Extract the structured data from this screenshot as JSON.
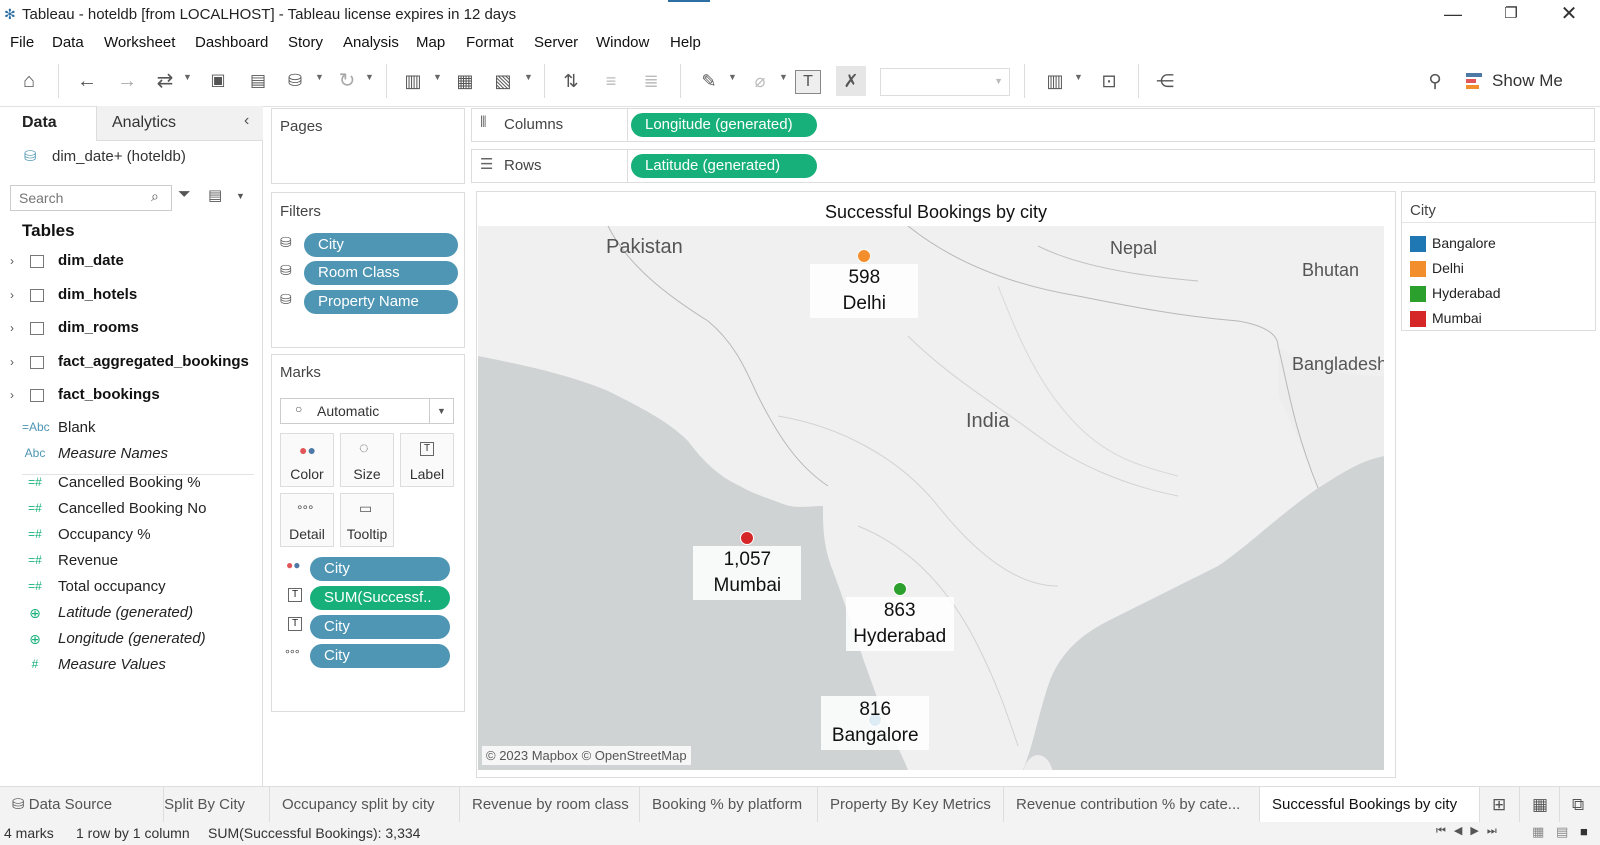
{
  "window": {
    "title": "Tableau - hoteldb [from LOCALHOST] - Tableau license expires in 12 days"
  },
  "menu": [
    "File",
    "Data",
    "Worksheet",
    "Dashboard",
    "Story",
    "Analysis",
    "Map",
    "Format",
    "Server",
    "Window",
    "Help"
  ],
  "toolbar": {
    "show_me": "Show Me"
  },
  "data_pane": {
    "tab_data": "Data",
    "tab_analytics": "Analytics",
    "datasource": "dim_date+ (hoteldb)",
    "search_placeholder": "Search",
    "tables_header": "Tables",
    "tables": [
      "dim_date",
      "dim_hotels",
      "dim_rooms",
      "fact_aggregated_bookings",
      "fact_bookings"
    ],
    "dims": [
      {
        "icon": "=Abc",
        "name": "Blank",
        "italic": false
      },
      {
        "icon": "Abc",
        "name": "Measure Names",
        "italic": true
      }
    ],
    "measures": [
      {
        "icon": "=#",
        "name": "Cancelled Booking %",
        "italic": false
      },
      {
        "icon": "=#",
        "name": "Cancelled Booking No",
        "italic": false
      },
      {
        "icon": "=#",
        "name": "Occupancy %",
        "italic": false
      },
      {
        "icon": "=#",
        "name": "Revenue",
        "italic": false
      },
      {
        "icon": "=#",
        "name": "Total occupancy",
        "italic": false
      },
      {
        "icon": "globe",
        "name": "Latitude (generated)",
        "italic": true
      },
      {
        "icon": "globe",
        "name": "Longitude (generated)",
        "italic": true
      },
      {
        "icon": "#",
        "name": "Measure Values",
        "italic": true
      }
    ]
  },
  "shelves": {
    "pages": "Pages",
    "filters": "Filters",
    "filter_pills": [
      "City",
      "Room Class",
      "Property Name"
    ],
    "marks": "Marks",
    "mark_type": "Automatic",
    "mark_buttons": [
      "Color",
      "Size",
      "Label",
      "Detail",
      "Tooltip"
    ],
    "mark_pills": [
      "City",
      "SUM(Successf..",
      "City",
      "City"
    ],
    "columns_label": "Columns",
    "columns_pill": "Longitude (generated)",
    "rows_label": "Rows",
    "rows_pill": "Latitude (generated)"
  },
  "view": {
    "title": "Successful Bookings by city",
    "attribution": "© 2023 Mapbox © OpenStreetMap",
    "map_labels": [
      "Pakistan",
      "Nepal",
      "Bhutan",
      "India",
      "Bangladesh"
    ]
  },
  "chart_data": {
    "type": "scatter",
    "title": "Successful Bookings by city",
    "xlabel": "Longitude (generated)",
    "ylabel": "Latitude (generated)",
    "points": [
      {
        "city": "Delhi",
        "value": 598,
        "label": "598",
        "lon": 77.2,
        "lat": 28.6,
        "color": "#f28e2b"
      },
      {
        "city": "Mumbai",
        "value": 1057,
        "label": "1,057",
        "lon": 72.9,
        "lat": 19.1,
        "color": "#d62728"
      },
      {
        "city": "Hyderabad",
        "value": 863,
        "label": "863",
        "lon": 78.5,
        "lat": 17.4,
        "color": "#2ca02c"
      },
      {
        "city": "Bangalore",
        "value": 816,
        "label": "816",
        "lon": 77.6,
        "lat": 12.97,
        "color": "#1f77b4"
      }
    ]
  },
  "legend": {
    "title": "City",
    "items": [
      {
        "name": "Bangalore",
        "color": "#1f77b4"
      },
      {
        "name": "Delhi",
        "color": "#f28e2b"
      },
      {
        "name": "Hyderabad",
        "color": "#2ca02c"
      },
      {
        "name": "Mumbai",
        "color": "#d62728"
      }
    ]
  },
  "tabs": [
    "Data Source",
    "Split By City",
    "Occupancy split by city",
    "Revenue by room class",
    "Booking % by platform",
    "Property By Key Metrics",
    "Revenue contribution % by cate...",
    "Successful Bookings by city"
  ],
  "status": {
    "marks": "4 marks",
    "rows": "1 row by 1 column",
    "sum": "SUM(Successful Bookings): 3,334"
  }
}
